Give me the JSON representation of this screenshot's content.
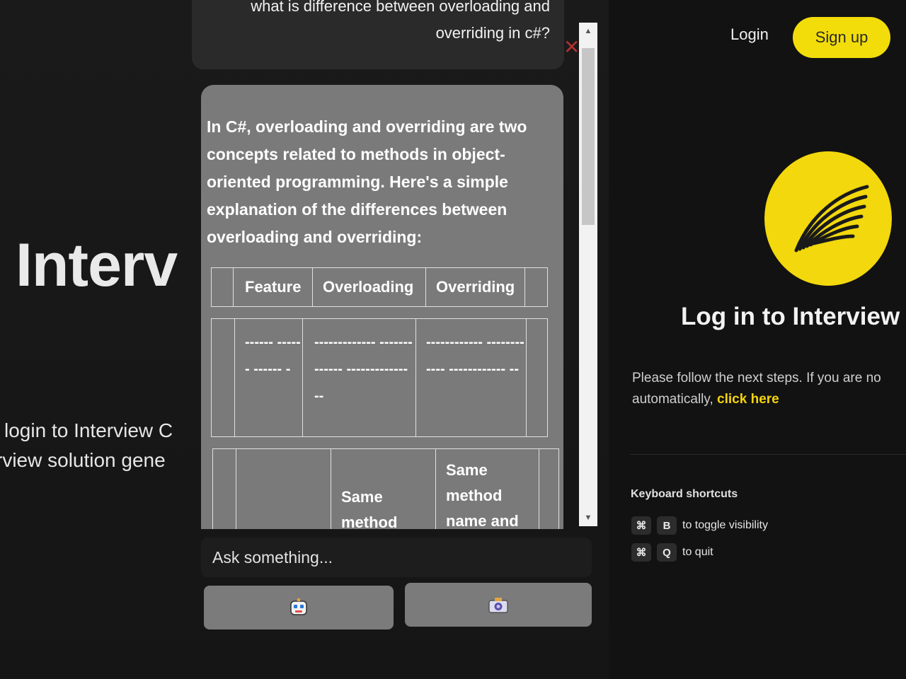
{
  "header": {
    "login_label": "Login",
    "signup_label": "Sign up"
  },
  "hero": {
    "title": "Interv",
    "subtitle_line1": "login to Interview C",
    "subtitle_line2": "rview solution gene"
  },
  "login_panel": {
    "heading": "Log in to Interview C",
    "steps_text": "Please follow the next steps. If you are no",
    "steps_text_2": "automatically,",
    "click_here": "click here",
    "logo_icon": "wing-icon",
    "accent_color": "#f2dd0a"
  },
  "shortcuts": {
    "title": "Keyboard shortcuts",
    "items": [
      {
        "modifier": "⌘",
        "key": "B",
        "label": "to toggle visibility"
      },
      {
        "modifier": "⌘",
        "key": "Q",
        "label": "to quit"
      }
    ]
  },
  "chat": {
    "question_line1": "what is difference between overloading and",
    "question_line2": "overriding in c#?",
    "answer_intro": "In C#, overloading and overriding are two concepts related to methods in object-oriented programming. Here's a simple explanation of the differences between overloading and overriding:",
    "table": {
      "headers": [
        "Feature",
        "Overloading",
        "Overriding"
      ],
      "separator": [
        "------ ------ ------ -",
        "------------- ------------- ------------- --",
        "------------ ------------ ------------ --"
      ],
      "first_row": [
        "",
        "Same method",
        "Same method name and"
      ]
    },
    "input_placeholder": "Ask something...",
    "buttons": [
      {
        "icon": "robot-icon"
      },
      {
        "icon": "camera-icon"
      }
    ]
  }
}
